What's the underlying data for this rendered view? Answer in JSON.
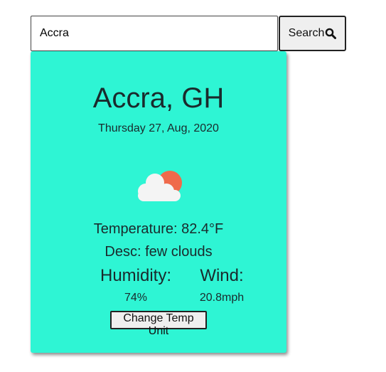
{
  "search": {
    "value": "Accra",
    "button_label": "Search",
    "icon": "search-icon"
  },
  "weather": {
    "city": "Accra, GH",
    "date": "Thursday 27, Aug, 2020",
    "icon": "few-clouds-day-icon",
    "temperature": "Temperature: 82.4°F",
    "description": "Desc: few clouds",
    "humidity_label": "Humidity:",
    "humidity_value": "74%",
    "wind_label": "Wind:",
    "wind_value": "20.8mph",
    "unit_button_label": "Change Temp Unit"
  },
  "colors": {
    "card_background": "#2ef5d4",
    "sun": "#ef6a4b",
    "cloud": "#f4f4f4"
  }
}
